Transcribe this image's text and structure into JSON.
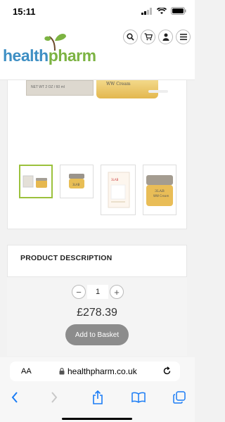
{
  "status": {
    "time": "15:11"
  },
  "header": {
    "logo_part1": "health",
    "logo_part2": "pharm",
    "icons": [
      "search-icon",
      "cart-icon",
      "user-icon",
      "menu-icon"
    ]
  },
  "product": {
    "box_label": "NET WT 2 OZ / 60 ml",
    "jar_brand": "3LAB",
    "jar_label": "WW Cream",
    "thumbnails": [
      "box-and-jar",
      "jar",
      "boxed-jar",
      "jar-closeup"
    ]
  },
  "description": {
    "title": "PRODUCT DESCRIPTION"
  },
  "purchase": {
    "quantity": "1",
    "minus": "−",
    "plus": "+",
    "price": "£278.39",
    "add_label": "Add to Basket"
  },
  "browser": {
    "aa": "AA",
    "url": "healthpharm.co.uk"
  },
  "colors": {
    "logo_blue": "#3e8fc4",
    "logo_green": "#7cb342",
    "thumb_active": "#9bc13c",
    "ios_blue": "#1a7cf5"
  }
}
